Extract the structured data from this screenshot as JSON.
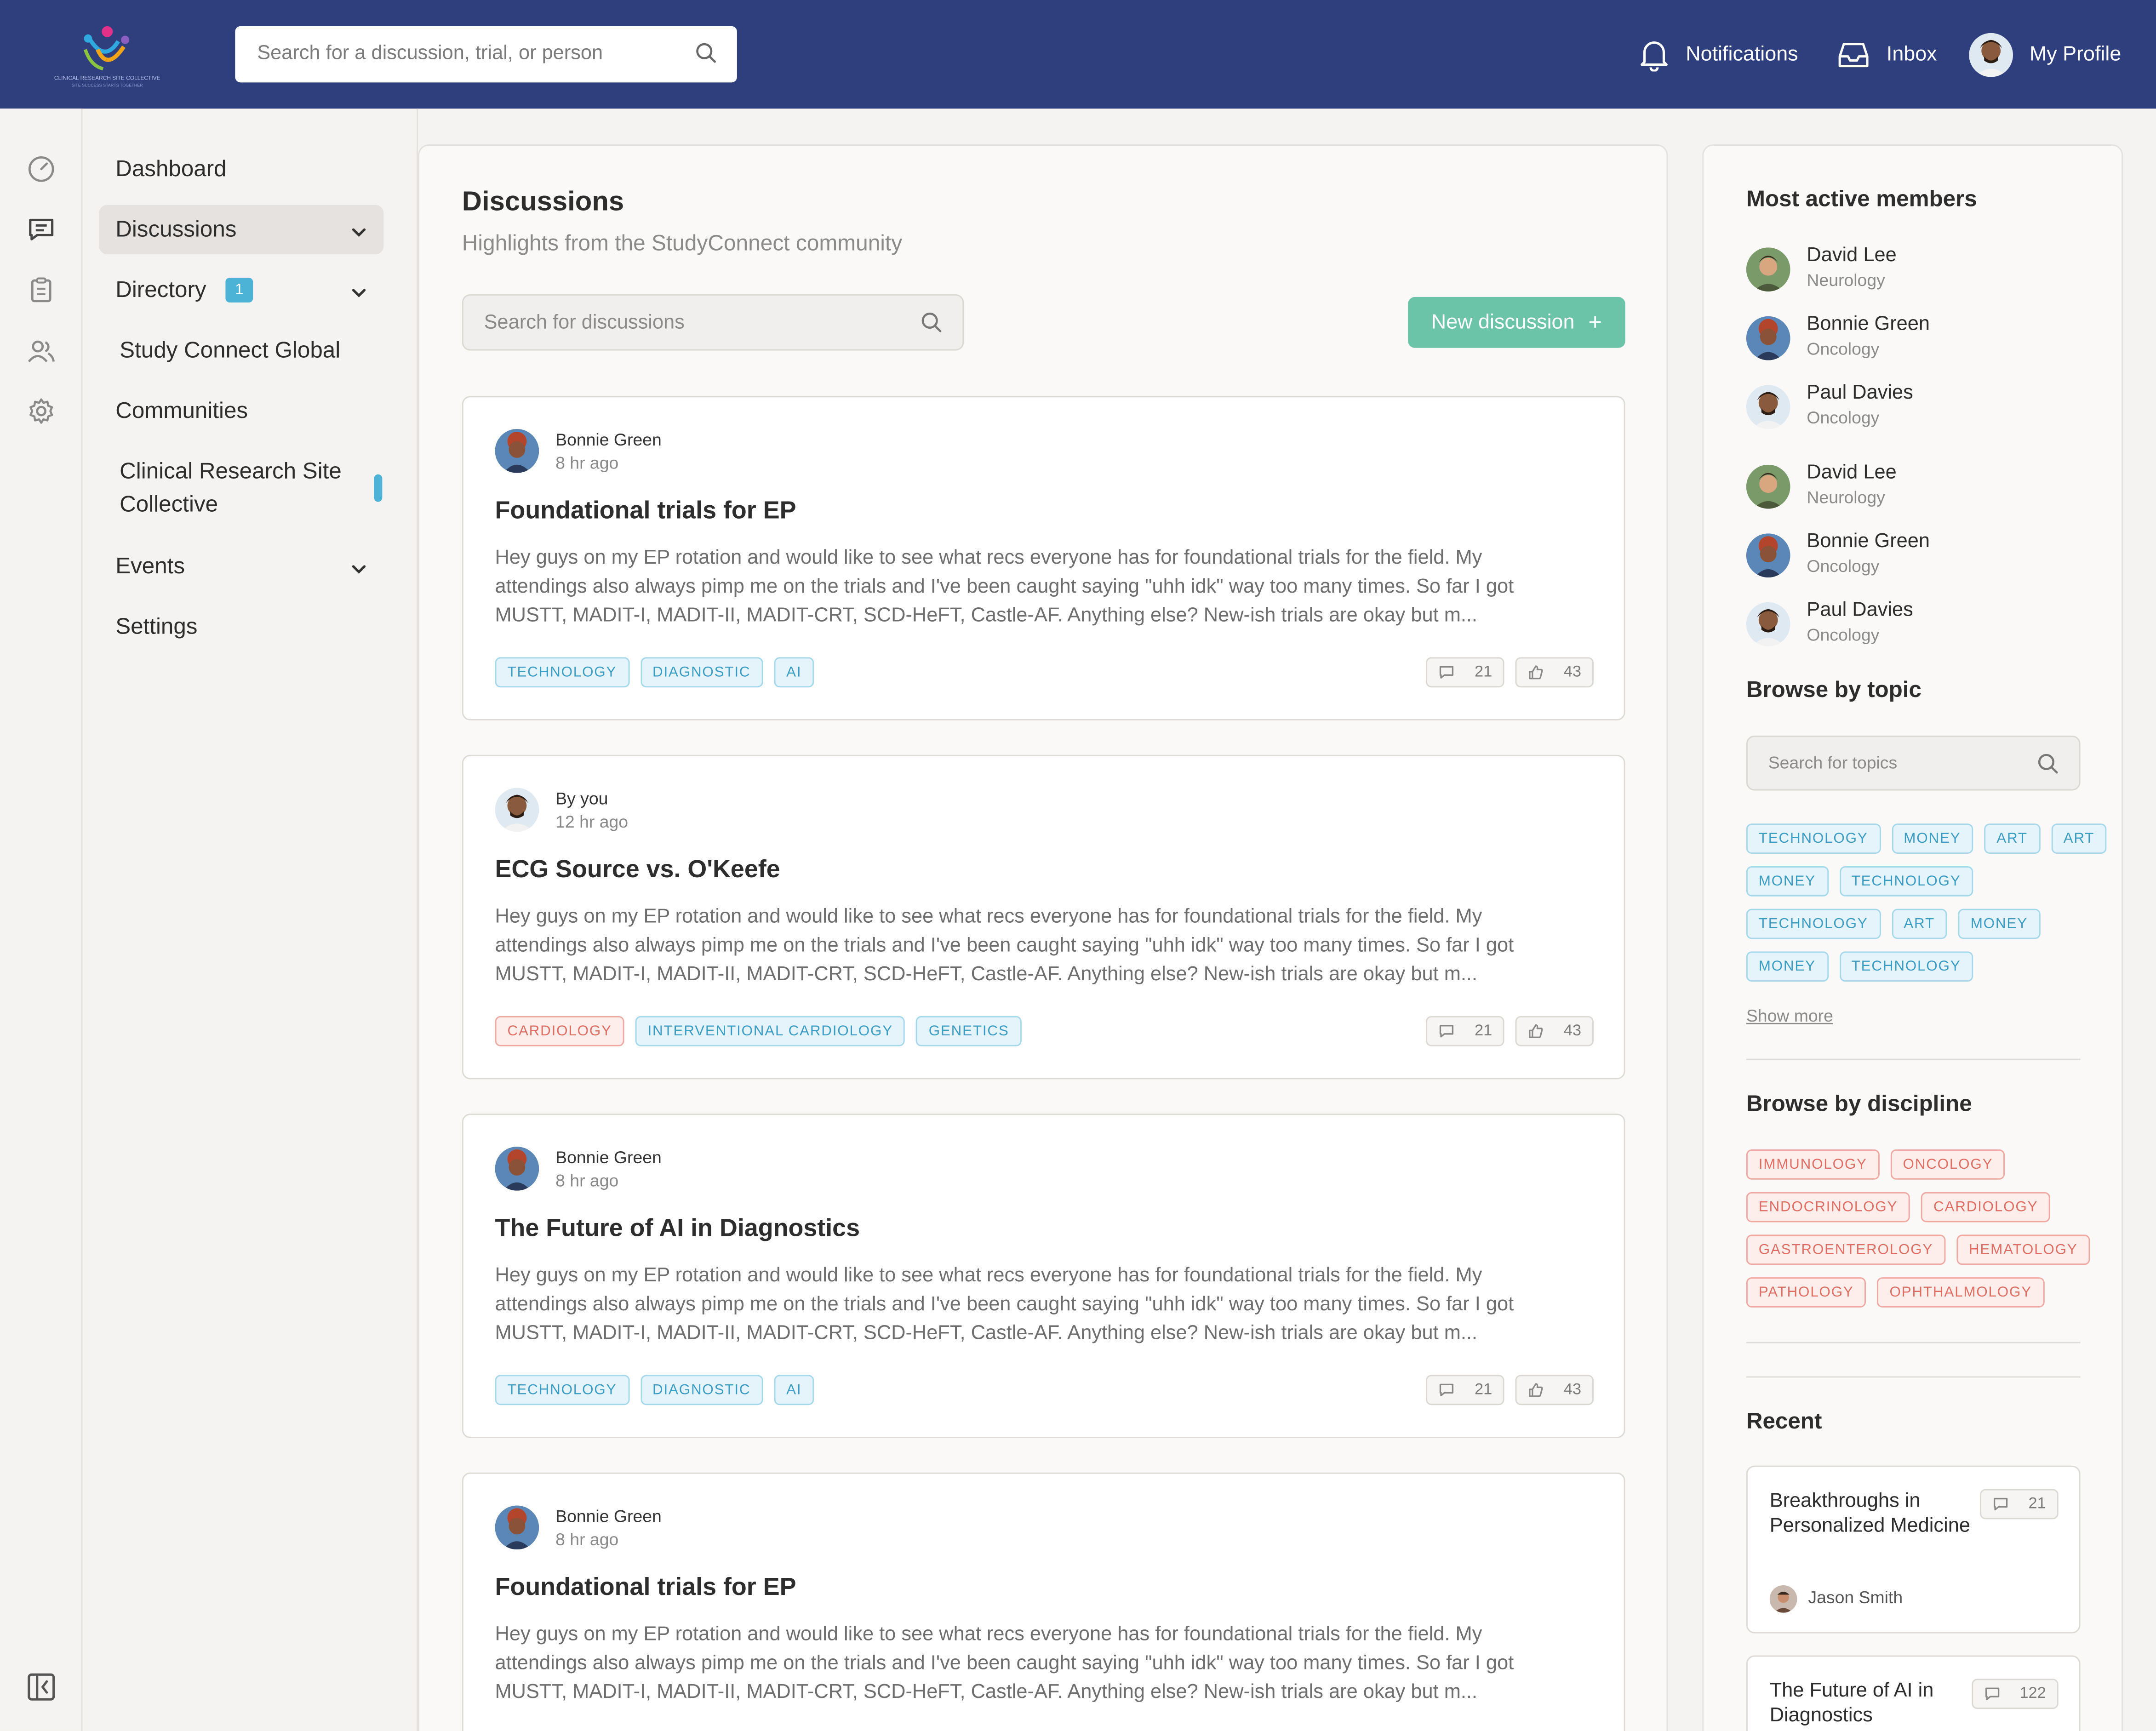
{
  "header": {
    "logo_text_top": "CLINICAL RESEARCH SITE COLLECTIVE",
    "logo_text_bottom": "SITE SUCCESS STARTS TOGETHER",
    "search_placeholder": "Search for a discussion, trial, or person",
    "notifications": "Notifications",
    "inbox": "Inbox",
    "profile": "My Profile"
  },
  "sidenav": {
    "dashboard": "Dashboard",
    "discussions": "Discussions",
    "directory": "Directory",
    "directory_badge": "1",
    "study_connect_global": "Study Connect Global",
    "communities": "Communities",
    "crsc_line1": "Clinical Research Site",
    "crsc_line2": "Collective",
    "events": "Events",
    "settings": "Settings"
  },
  "main": {
    "title": "Discussions",
    "subtitle": "Highlights from the StudyConnect community",
    "search_placeholder": "Search for discussions",
    "new_button": "New discussion",
    "posts": [
      {
        "author": "Bonnie Green",
        "time": "8 hr ago",
        "title": "Foundational trials for EP",
        "body": "Hey guys on my EP rotation and would like to see what recs everyone has for foundational trials for the field. My attendings also always pimp me on the trials and I've been caught saying \"uhh idk\" way too many times. So far I got MUSTT, MADIT-I, MADIT-II, MADIT-CRT, SCD-HeFT, Castle-AF. Anything else? New-ish trials are okay but m...",
        "tags": [
          {
            "label": "TECHNOLOGY",
            "color": "blue"
          },
          {
            "label": "DIAGNOSTIC",
            "color": "blue"
          },
          {
            "label": "AI",
            "color": "blue"
          }
        ],
        "comments": "21",
        "likes": "43",
        "avatar": "bonnie"
      },
      {
        "author": "By you",
        "time": "12 hr ago",
        "title": "ECG Source vs. O'Keefe",
        "body": "Hey guys on my EP rotation and would like to see what recs everyone has for foundational trials for the field. My attendings also always pimp me on the trials and I've been caught saying \"uhh idk\" way too many times. So far I got MUSTT, MADIT-I, MADIT-II, MADIT-CRT, SCD-HeFT, Castle-AF. Anything else? New-ish trials are okay but m...",
        "tags": [
          {
            "label": "CARDIOLOGY",
            "color": "red"
          },
          {
            "label": "INTERVENTIONAL CARDIOLOGY",
            "color": "blue"
          },
          {
            "label": "GENETICS",
            "color": "blue"
          }
        ],
        "comments": "21",
        "likes": "43",
        "avatar": "paul"
      },
      {
        "author": "Bonnie Green",
        "time": "8 hr ago",
        "title": "The Future of AI in Diagnostics",
        "body": "Hey guys on my EP rotation and would like to see what recs everyone has for foundational trials for the field. My attendings also always pimp me on the trials and I've been caught saying \"uhh idk\" way too many times. So far I got MUSTT, MADIT-I, MADIT-II, MADIT-CRT, SCD-HeFT, Castle-AF. Anything else? New-ish trials are okay but m...",
        "tags": [
          {
            "label": "TECHNOLOGY",
            "color": "blue"
          },
          {
            "label": "DIAGNOSTIC",
            "color": "blue"
          },
          {
            "label": "AI",
            "color": "blue"
          }
        ],
        "comments": "21",
        "likes": "43",
        "avatar": "bonnie"
      },
      {
        "author": "Bonnie Green",
        "time": "8 hr ago",
        "title": "Foundational trials for EP",
        "body": "Hey guys on my EP rotation and would like to see what recs everyone has for foundational trials for the field. My attendings also always pimp me on the trials and I've been caught saying \"uhh idk\" way too many times. So far I got MUSTT, MADIT-I, MADIT-II, MADIT-CRT, SCD-HeFT, Castle-AF. Anything else? New-ish trials are okay but m...",
        "tags": [],
        "comments": "",
        "likes": "",
        "avatar": "bonnie"
      }
    ]
  },
  "right": {
    "most_active_title": "Most active members",
    "members": [
      {
        "name": "David Lee",
        "discipline": "Neurology",
        "avatar": "david"
      },
      {
        "name": "Bonnie Green",
        "discipline": "Oncology",
        "avatar": "bonnie"
      },
      {
        "name": "Paul Davies",
        "discipline": "Oncology",
        "avatar": "paul"
      },
      {
        "name": "David Lee",
        "discipline": "Neurology",
        "avatar": "david"
      },
      {
        "name": "Bonnie Green",
        "discipline": "Oncology",
        "avatar": "bonnie"
      },
      {
        "name": "Paul Davies",
        "discipline": "Oncology",
        "avatar": "paul"
      }
    ],
    "browse_topic_title": "Browse by topic",
    "topic_search_placeholder": "Search for topics",
    "topic_rows": [
      [
        "TECHNOLOGY",
        "MONEY",
        "ART",
        "ART"
      ],
      [
        "MONEY",
        "TECHNOLOGY"
      ],
      [
        "TECHNOLOGY",
        "ART",
        "MONEY"
      ],
      [
        "MONEY",
        "TECHNOLOGY"
      ]
    ],
    "show_more": "Show more",
    "browse_discipline_title": "Browse by discipline",
    "discipline_rows": [
      [
        "IMMUNOLOGY",
        "ONCOLOGY"
      ],
      [
        "ENDOCRINOLOGY",
        "CARDIOLOGY"
      ],
      [
        "GASTROENTEROLOGY",
        "HEMATOLOGY"
      ],
      [
        "PATHOLOGY",
        "OPHTHALMOLOGY"
      ]
    ],
    "recent_title": "Recent",
    "recent": [
      {
        "title": "Breakthroughs in Personalized Medicine",
        "comments": "21",
        "author": "Jason Smith"
      },
      {
        "title": "The Future of AI in Diagnostics",
        "comments": "122",
        "author": ""
      }
    ]
  },
  "colors": {
    "header_bg": "#2f3f7e",
    "accent_green": "#6cc4a8",
    "tag_blue": "#3a9cc4",
    "tag_red": "#df6d62",
    "badge_blue": "#4cb3d6"
  }
}
